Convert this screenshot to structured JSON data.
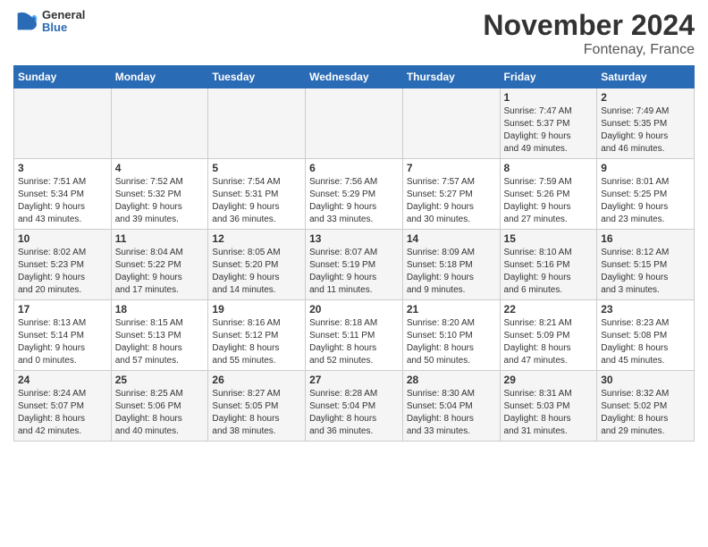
{
  "header": {
    "logo_general": "General",
    "logo_blue": "Blue",
    "month_title": "November 2024",
    "location": "Fontenay, France"
  },
  "weekdays": [
    "Sunday",
    "Monday",
    "Tuesday",
    "Wednesday",
    "Thursday",
    "Friday",
    "Saturday"
  ],
  "weeks": [
    [
      {
        "day": "",
        "info": ""
      },
      {
        "day": "",
        "info": ""
      },
      {
        "day": "",
        "info": ""
      },
      {
        "day": "",
        "info": ""
      },
      {
        "day": "",
        "info": ""
      },
      {
        "day": "1",
        "info": "Sunrise: 7:47 AM\nSunset: 5:37 PM\nDaylight: 9 hours\nand 49 minutes."
      },
      {
        "day": "2",
        "info": "Sunrise: 7:49 AM\nSunset: 5:35 PM\nDaylight: 9 hours\nand 46 minutes."
      }
    ],
    [
      {
        "day": "3",
        "info": "Sunrise: 7:51 AM\nSunset: 5:34 PM\nDaylight: 9 hours\nand 43 minutes."
      },
      {
        "day": "4",
        "info": "Sunrise: 7:52 AM\nSunset: 5:32 PM\nDaylight: 9 hours\nand 39 minutes."
      },
      {
        "day": "5",
        "info": "Sunrise: 7:54 AM\nSunset: 5:31 PM\nDaylight: 9 hours\nand 36 minutes."
      },
      {
        "day": "6",
        "info": "Sunrise: 7:56 AM\nSunset: 5:29 PM\nDaylight: 9 hours\nand 33 minutes."
      },
      {
        "day": "7",
        "info": "Sunrise: 7:57 AM\nSunset: 5:27 PM\nDaylight: 9 hours\nand 30 minutes."
      },
      {
        "day": "8",
        "info": "Sunrise: 7:59 AM\nSunset: 5:26 PM\nDaylight: 9 hours\nand 27 minutes."
      },
      {
        "day": "9",
        "info": "Sunrise: 8:01 AM\nSunset: 5:25 PM\nDaylight: 9 hours\nand 23 minutes."
      }
    ],
    [
      {
        "day": "10",
        "info": "Sunrise: 8:02 AM\nSunset: 5:23 PM\nDaylight: 9 hours\nand 20 minutes."
      },
      {
        "day": "11",
        "info": "Sunrise: 8:04 AM\nSunset: 5:22 PM\nDaylight: 9 hours\nand 17 minutes."
      },
      {
        "day": "12",
        "info": "Sunrise: 8:05 AM\nSunset: 5:20 PM\nDaylight: 9 hours\nand 14 minutes."
      },
      {
        "day": "13",
        "info": "Sunrise: 8:07 AM\nSunset: 5:19 PM\nDaylight: 9 hours\nand 11 minutes."
      },
      {
        "day": "14",
        "info": "Sunrise: 8:09 AM\nSunset: 5:18 PM\nDaylight: 9 hours\nand 9 minutes."
      },
      {
        "day": "15",
        "info": "Sunrise: 8:10 AM\nSunset: 5:16 PM\nDaylight: 9 hours\nand 6 minutes."
      },
      {
        "day": "16",
        "info": "Sunrise: 8:12 AM\nSunset: 5:15 PM\nDaylight: 9 hours\nand 3 minutes."
      }
    ],
    [
      {
        "day": "17",
        "info": "Sunrise: 8:13 AM\nSunset: 5:14 PM\nDaylight: 9 hours\nand 0 minutes."
      },
      {
        "day": "18",
        "info": "Sunrise: 8:15 AM\nSunset: 5:13 PM\nDaylight: 8 hours\nand 57 minutes."
      },
      {
        "day": "19",
        "info": "Sunrise: 8:16 AM\nSunset: 5:12 PM\nDaylight: 8 hours\nand 55 minutes."
      },
      {
        "day": "20",
        "info": "Sunrise: 8:18 AM\nSunset: 5:11 PM\nDaylight: 8 hours\nand 52 minutes."
      },
      {
        "day": "21",
        "info": "Sunrise: 8:20 AM\nSunset: 5:10 PM\nDaylight: 8 hours\nand 50 minutes."
      },
      {
        "day": "22",
        "info": "Sunrise: 8:21 AM\nSunset: 5:09 PM\nDaylight: 8 hours\nand 47 minutes."
      },
      {
        "day": "23",
        "info": "Sunrise: 8:23 AM\nSunset: 5:08 PM\nDaylight: 8 hours\nand 45 minutes."
      }
    ],
    [
      {
        "day": "24",
        "info": "Sunrise: 8:24 AM\nSunset: 5:07 PM\nDaylight: 8 hours\nand 42 minutes."
      },
      {
        "day": "25",
        "info": "Sunrise: 8:25 AM\nSunset: 5:06 PM\nDaylight: 8 hours\nand 40 minutes."
      },
      {
        "day": "26",
        "info": "Sunrise: 8:27 AM\nSunset: 5:05 PM\nDaylight: 8 hours\nand 38 minutes."
      },
      {
        "day": "27",
        "info": "Sunrise: 8:28 AM\nSunset: 5:04 PM\nDaylight: 8 hours\nand 36 minutes."
      },
      {
        "day": "28",
        "info": "Sunrise: 8:30 AM\nSunset: 5:04 PM\nDaylight: 8 hours\nand 33 minutes."
      },
      {
        "day": "29",
        "info": "Sunrise: 8:31 AM\nSunset: 5:03 PM\nDaylight: 8 hours\nand 31 minutes."
      },
      {
        "day": "30",
        "info": "Sunrise: 8:32 AM\nSunset: 5:02 PM\nDaylight: 8 hours\nand 29 minutes."
      }
    ]
  ]
}
